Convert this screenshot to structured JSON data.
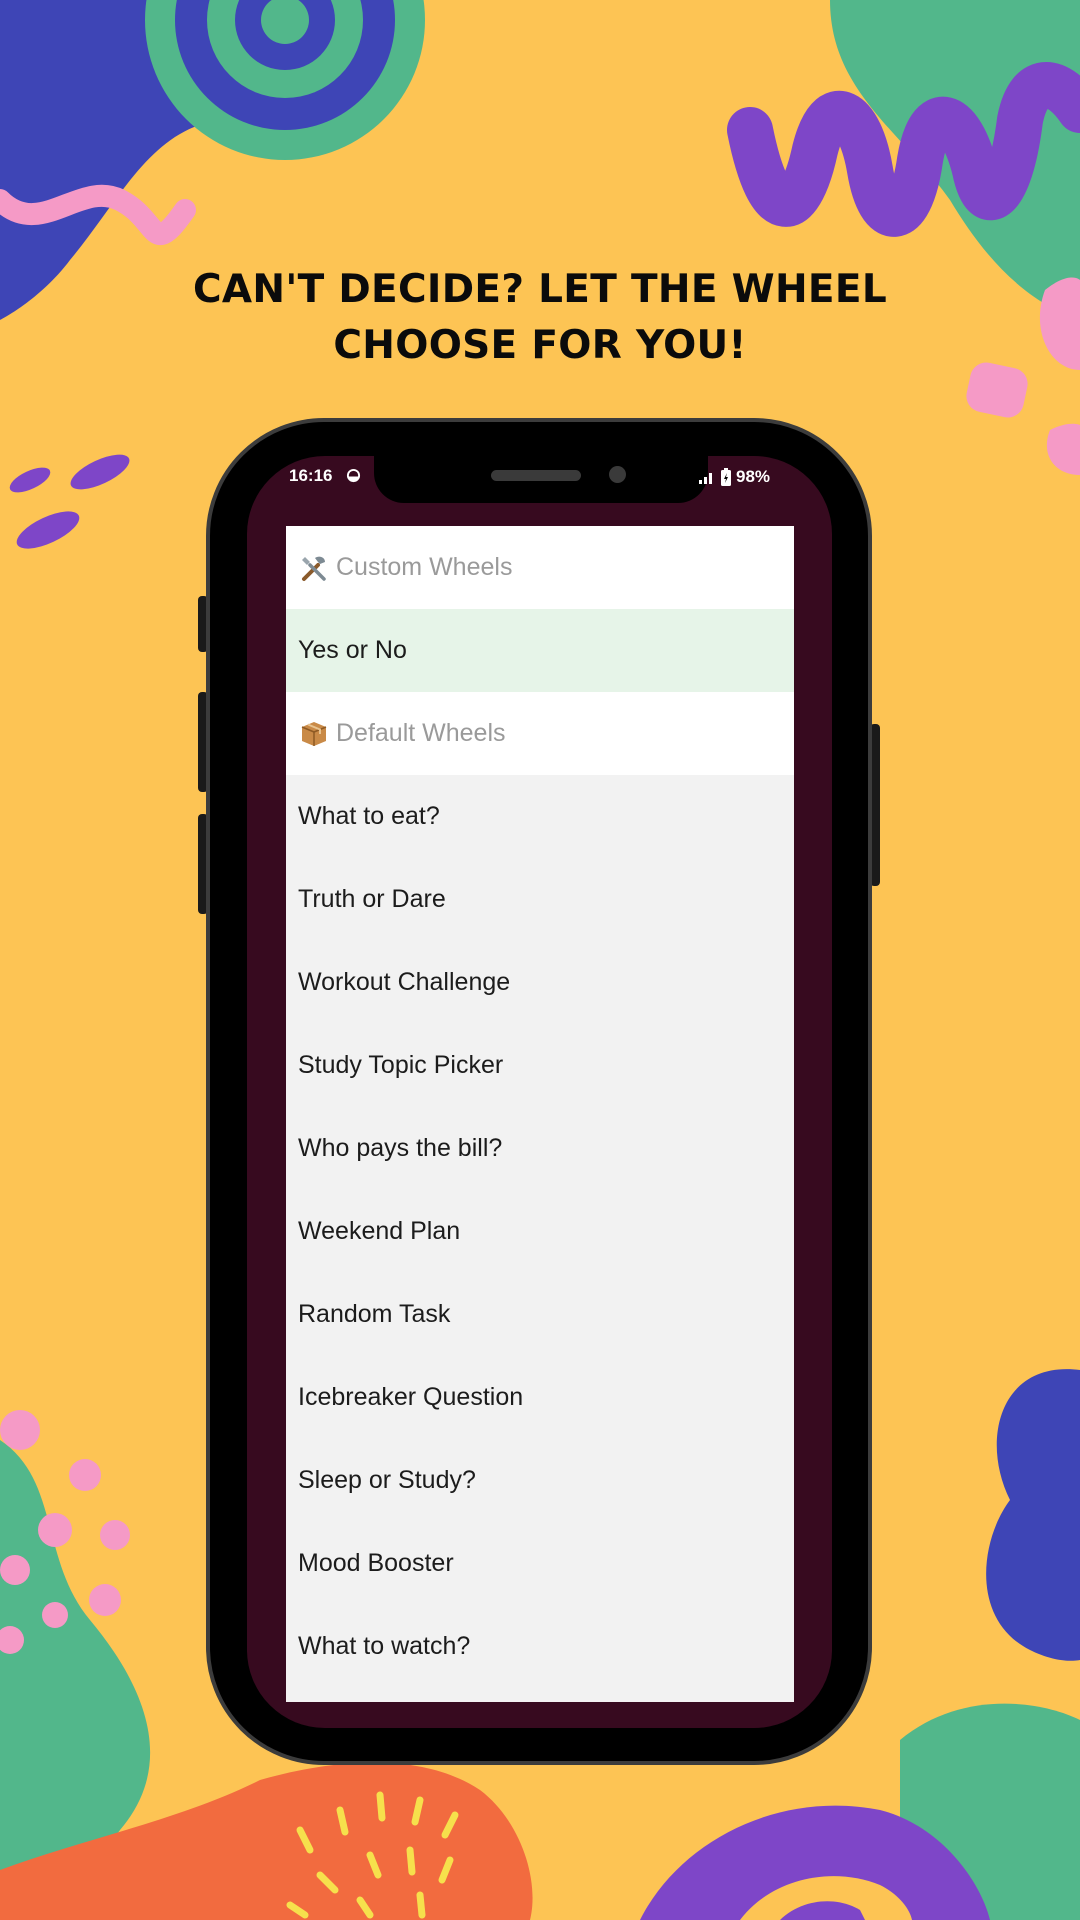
{
  "headline": {
    "line1": "CAN'T DECIDE? LET THE WHEEL",
    "line2": "CHOOSE FOR YOU!"
  },
  "status_bar": {
    "time": "16:16",
    "battery": "98%"
  },
  "menu": {
    "custom_header": {
      "icon": "tools-icon",
      "label": "Custom Wheels"
    },
    "custom_items": [
      "Yes or No"
    ],
    "default_header": {
      "icon": "package-icon",
      "label": "Default Wheels"
    },
    "default_items": [
      "What to eat?",
      "Truth or Dare",
      "Workout Challenge",
      "Study Topic Picker",
      "Who pays the bill?",
      "Weekend Plan",
      "Random Task",
      "Icebreaker Question",
      "Sleep or Study?",
      "Mood Booster",
      "What to watch?"
    ]
  },
  "colors": {
    "background": "#FDC454",
    "screen": "#370A1F",
    "selected_row": "#E6F4E8",
    "menu_bg": "#F2F2F2"
  }
}
